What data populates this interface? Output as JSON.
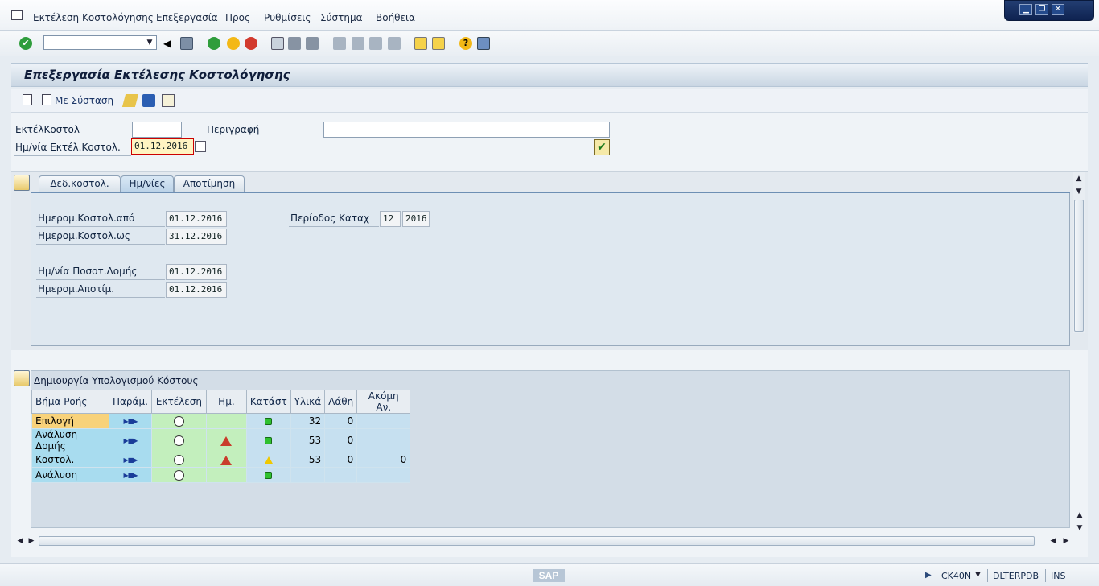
{
  "menu": {
    "items": [
      "Εκτέλεση Κοστολόγησης",
      "Επεξεργασία",
      "Προς",
      "Ρυθμίσεις",
      "Σύστημα",
      "Βοήθεια"
    ]
  },
  "window_controls": [
    "minimize",
    "restore",
    "close"
  ],
  "toolbar": {
    "command_field": "",
    "icons": [
      "enter-icon",
      "back-icon",
      "save-icon",
      "back-green-icon",
      "exit-icon",
      "cancel-icon",
      "print-icon",
      "find-icon",
      "find-next-icon",
      "first-page-icon",
      "prev-page-icon",
      "next-page-icon",
      "last-page-icon",
      "new-session-icon",
      "shortcut-icon",
      "help-icon",
      "layout-icon"
    ]
  },
  "page_title": "Επεξεργασία Εκτέλεσης Κοστολόγησης",
  "app_toolbar": {
    "with_reference_label": "Με Σύσταση"
  },
  "header_fields": {
    "costing_run_label": "ΕκτέλΚοστολ",
    "costing_run_value": "",
    "description_label": "Περιγραφή",
    "description_value": "",
    "costing_run_date_label": "Ημ/νία Εκτέλ.Κοστολ.",
    "costing_run_date_value": "01.12.2016"
  },
  "tabs": [
    {
      "label": "Δεδ.κοστολ.",
      "active": false
    },
    {
      "label": "Ημ/νίες",
      "active": true
    },
    {
      "label": "Αποτίμηση",
      "active": false
    }
  ],
  "dates_tab": {
    "costing_from_label": "Ημερομ.Κοστολ.από",
    "costing_from_value": "01.12.2016",
    "costing_to_label": "Ημερομ.Κοστολ.ως",
    "costing_to_value": "31.12.2016",
    "qty_structure_date_label": "Ημ/νία Ποσοτ.Δομής",
    "qty_structure_date_value": "01.12.2016",
    "valuation_date_label": "Ημερομ.Αποτίμ.",
    "valuation_date_value": "01.12.2016",
    "posting_period_label": "Περίοδος Καταχ",
    "posting_period_value": "12",
    "posting_year_value": "2016"
  },
  "section2": {
    "title": "Δημιουργία Υπολογισμού Κόστους",
    "columns": [
      "Βήμα Ροής",
      "Παράμ.",
      "Εκτέλεση",
      "Ημ.",
      "Κατάστ",
      "Υλικά",
      "Λάθη",
      "Ακόμη Αν."
    ],
    "rows": [
      {
        "step": "Επιλογή",
        "status": "green",
        "log": false,
        "materials": "32",
        "errors": "0",
        "more": ""
      },
      {
        "step": "Ανάλυση Δομής",
        "status": "green",
        "log": true,
        "materials": "53",
        "errors": "0",
        "more": ""
      },
      {
        "step": "Κοστολ.",
        "status": "yellow",
        "log": true,
        "materials": "53",
        "errors": "0",
        "more": "0"
      },
      {
        "step": "Ανάλυση",
        "status": "green",
        "log": false,
        "materials": "",
        "errors": "",
        "more": ""
      }
    ]
  },
  "statusbar": {
    "logo": "SAP",
    "transaction": "CK40N",
    "system": "DLTERPDB",
    "mode": "INS"
  }
}
